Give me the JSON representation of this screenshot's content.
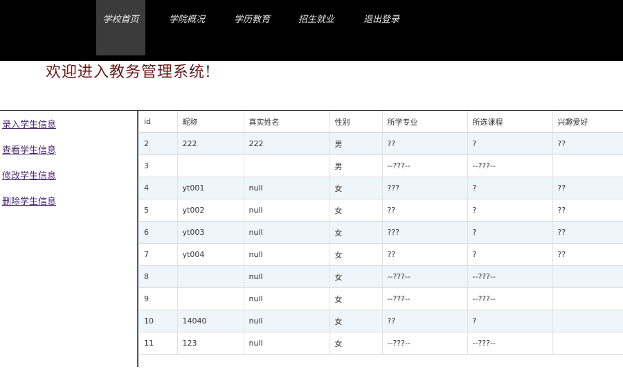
{
  "nav": {
    "items": [
      {
        "label": "学校首页",
        "active": true
      },
      {
        "label": "学院概况",
        "active": false
      },
      {
        "label": "学历教育",
        "active": false
      },
      {
        "label": "招生就业",
        "active": false
      },
      {
        "label": "退出登录",
        "active": false
      }
    ]
  },
  "welcome": "欢迎进入教务管理系统!",
  "sidebar": {
    "links": [
      "录入学生信息",
      "查看学生信息",
      "修改学生信息",
      "删除学生信息"
    ]
  },
  "table": {
    "headers": [
      "id",
      "昵称",
      "真实姓名",
      "性别",
      "所学专业",
      "所选课程",
      "兴趣爱好"
    ],
    "rows": [
      [
        "2",
        "222",
        "222",
        "男",
        "??",
        "?",
        "??"
      ],
      [
        "3",
        "",
        "",
        "男",
        "--???--",
        "--???--",
        ""
      ],
      [
        "4",
        "yt001",
        "null",
        "女",
        "???",
        "?",
        "??"
      ],
      [
        "5",
        "yt002",
        "null",
        "女",
        "??",
        "?",
        "??"
      ],
      [
        "6",
        "yt003",
        "null",
        "女",
        "???",
        "?",
        "??"
      ],
      [
        "7",
        "yt004",
        "null",
        "女",
        "??",
        "?",
        "??"
      ],
      [
        "8",
        "",
        "null",
        "女",
        "--???--",
        "--???--",
        ""
      ],
      [
        "9",
        "",
        "null",
        "女",
        "--???--",
        "--???--",
        ""
      ],
      [
        "10",
        "14040",
        "null",
        "女",
        "??",
        "?",
        ""
      ],
      [
        "11",
        "123",
        "null",
        "女",
        "--???--",
        "--???--",
        ""
      ]
    ]
  }
}
